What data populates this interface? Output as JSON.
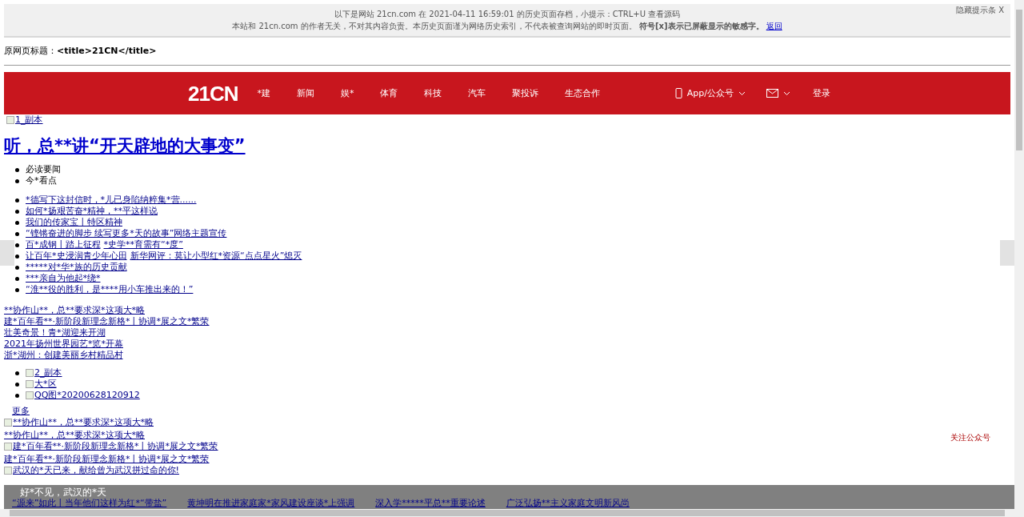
{
  "archive_notice": {
    "line_1": "以下是网站 21cn.com 在 2021-04-11 16:59:01 的历史页面存档，小提示：CTRL+U 查看源码",
    "line_2": "本站和 21cn.com 的作者无关，不对其内容负责。本历史页面谨为网络历史索引，不代表被查询网站的即时页面。",
    "line_2_bold": "符号[x]表示已屏蔽显示的敏感字。",
    "back_link": "返回",
    "hide_link": "隐藏提示条",
    "close": "X"
  },
  "original_title": {
    "label": "原网页标题：",
    "value": "<title>21CN</title>"
  },
  "navbar": {
    "logo": "21CN",
    "items": [
      "*建",
      "新闻",
      "娱*",
      "体育",
      "科技",
      "汽车",
      "聚投诉",
      "生态合作"
    ],
    "app_menu": "App/公众号",
    "login": "登录"
  },
  "banner_image_alt": "1_副本",
  "headline": "听，总**讲“开天辟地的大事变”",
  "tabs": [
    "必读要闻",
    "今*看点"
  ],
  "news_list": [
    {
      "parts": [
        "*德写下这封信时，*儿已身陷纳粹集*营......"
      ]
    },
    {
      "parts": [
        "如何*扬艰苦奋*精神，**平这样说"
      ]
    },
    {
      "parts": [
        "我们的传家宝丨特区精神"
      ]
    },
    {
      "parts": [
        "“铿锵奋进的脚步 续写更多*天的故事”网络主题宣传"
      ]
    },
    {
      "parts": [
        "百*成钢丨踏上征程",
        "*史学**育需有“*度”"
      ]
    },
    {
      "parts": [
        "让百年*史浸润青少年心田",
        "新华网评：莫让小型红*资源“点点星火”熄灭"
      ]
    },
    {
      "parts": [
        "*****对*华*族的历史贡献"
      ]
    },
    {
      "parts": [
        "***亲自为他起*绕*"
      ]
    },
    {
      "parts": [
        "“淮**役的胜利，是****用小车推出来的！”"
      ]
    }
  ],
  "link_list": [
    "**协作山**，总**要求深*这项大*略",
    "建*百年看**·新阶段新理念新格*丨协调*展之文*繁荣",
    "壮美奇景！青*湖迎来开湖",
    "2021年扬州世界园艺*览*开幕",
    "浙*湖州：创建美丽乡村精品村"
  ],
  "image_list": [
    "2_副本",
    "大*区",
    "QQ图*20200628120912"
  ],
  "more_link": "更多",
  "feature_list": [
    {
      "kind": "image",
      "text": "**协作山**，总**要求深*这项大*略"
    },
    {
      "kind": "link",
      "text": "**协作山**，总**要求深*这项大*略"
    },
    {
      "kind": "image",
      "text": "建*百年看**·新阶段新理念新格*丨协调*展之文*繁荣"
    },
    {
      "kind": "link",
      "text": "建*百年看**·新阶段新理念新格*丨协调*展之文*繁荣"
    },
    {
      "kind": "image",
      "text": "武汉的*天已来，献给曾为武汉拼过命的你!"
    }
  ],
  "follow_label": "关注公众号",
  "bottom_banner": {
    "caption": "好*不见，武汉的*天",
    "links": [
      "“源来”如此丨当年他们这样为红*“带盐”",
      "黄坤明在推进家庭家*家风建设座谈*上强调",
      "深入学*****平总**重要论述",
      "广泛弘扬**主义家庭文明新风尚"
    ]
  }
}
